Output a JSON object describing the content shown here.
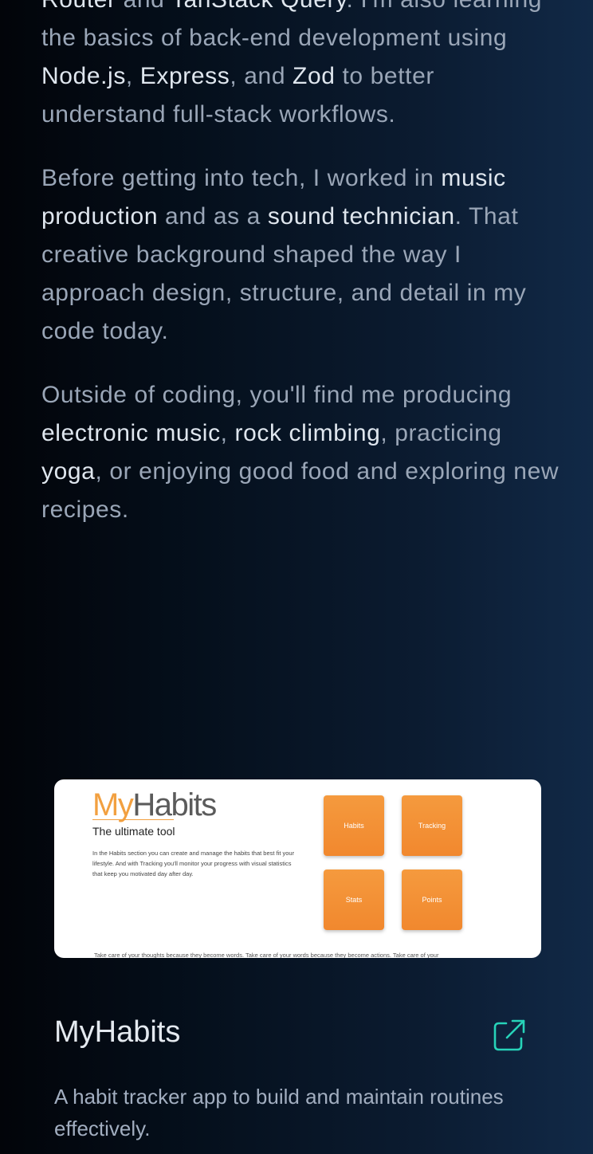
{
  "about": {
    "p1": {
      "s1": "Router",
      "t1": " and ",
      "s2": "TanStack Query",
      "t2": ". I'm also learning the basics of back-end development using ",
      "s3": "Node.js",
      "t3": ", ",
      "s4": "Express",
      "t4": ", and ",
      "s5": "Zod",
      "t5": " to better understand full-stack workflows."
    },
    "p2": {
      "t1": "Before getting into tech, I worked in ",
      "s1": "music production",
      "t2": " and as a ",
      "s2": "sound technician",
      "t3": ". That creative background shaped the way I approach design, structure, and detail in my code today."
    },
    "p3": {
      "t1": "Outside of coding, you'll find me producing ",
      "s1": "electronic music",
      "t2": ", ",
      "s2": "rock climbing",
      "t3": ", practicing ",
      "s3": "yoga",
      "t4": ", or enjoying good food and exploring new recipes."
    }
  },
  "project": {
    "preview": {
      "logo_my": "My",
      "logo_habits": "Habits",
      "tagline": "The ultimate tool",
      "description": "In the Habits section you can create and manage the habits that best fit your lifestyle. And with Tracking you'll monitor your progress with visual statistics that keep you motivated day after day.",
      "tiles": [
        "Habits",
        "Tracking",
        "Stats",
        "Points"
      ],
      "footer_quote": "Take care of your thoughts because they become words. Take care of your words because they become actions. Take care of your"
    },
    "title": "MyHabits",
    "description": "A habit tracker app to build and maintain routines effectively.",
    "link_icon": "external-link-icon",
    "colors": {
      "link_icon": "#27d3b9",
      "brand_orange": "#f2a040",
      "tile_orange": "#f59a3e"
    }
  }
}
